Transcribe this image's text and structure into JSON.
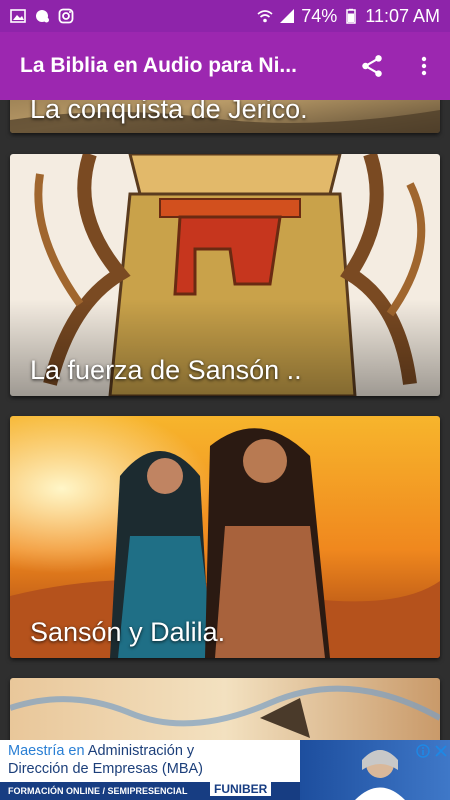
{
  "status_bar": {
    "battery": "74%",
    "time": "11:07 AM"
  },
  "app_bar": {
    "title": "La Biblia en Audio para Ni..."
  },
  "cards": [
    {
      "title": "La conquista de Jerico."
    },
    {
      "title": "La fuerza de Sansón .."
    },
    {
      "title": "Sansón y Dalila."
    },
    {
      "title": ""
    }
  ],
  "ad": {
    "line1_a": "Maestría en ",
    "line1_b": "Administración y",
    "line2": "Dirección de Empresas (MBA)",
    "strip": "FORMACIÓN ONLINE / SEMIPRESENCIAL",
    "brand": "FUNIBER"
  },
  "colors": {
    "status_bar": "#8e24aa",
    "app_bar": "#9c27b0",
    "background": "#2f2f2f"
  }
}
